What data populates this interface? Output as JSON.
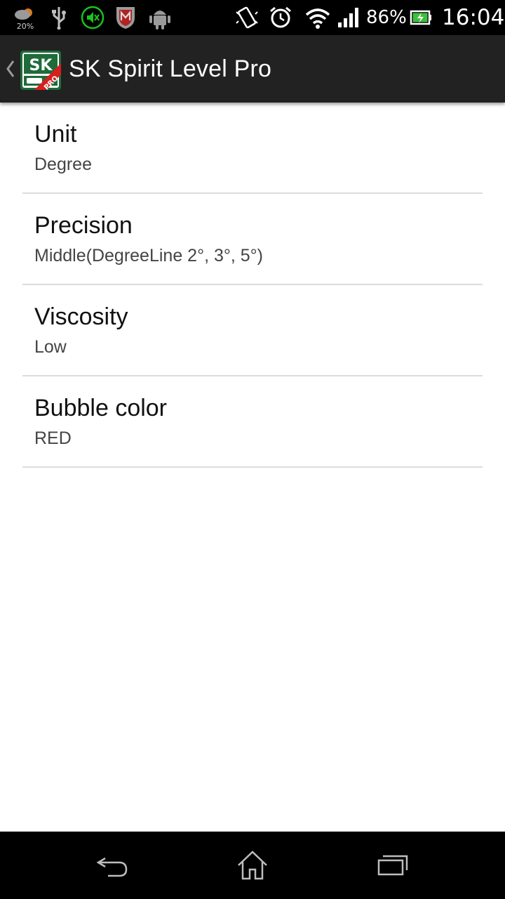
{
  "status_bar": {
    "weather_percent": "20%",
    "battery_percent": "86%",
    "time": "16:04"
  },
  "action_bar": {
    "title": "SK Spirit Level Pro",
    "icon_letters": "SK",
    "icon_badge": "PRO"
  },
  "preferences": [
    {
      "title": "Unit",
      "summary": "Degree"
    },
    {
      "title": "Precision",
      "summary": "Middle(DegreeLine 2°, 3°, 5°)"
    },
    {
      "title": "Viscosity",
      "summary": "Low"
    },
    {
      "title": "Bubble color",
      "summary": "RED"
    }
  ],
  "icons": {
    "status_left": [
      "weather-icon",
      "usb-icon",
      "mute-icon",
      "mcafee-icon",
      "android-icon"
    ],
    "status_right": [
      "vibrate-icon",
      "alarm-icon",
      "wifi-icon",
      "signal-icon",
      "battery-icon"
    ],
    "nav": [
      "back-icon",
      "home-icon",
      "recent-apps-icon"
    ]
  },
  "colors": {
    "action_bar": "#222222",
    "app_icon_green": "#1f6b3a",
    "badge_red": "#d81e1e",
    "mute_green": "#19c419"
  }
}
